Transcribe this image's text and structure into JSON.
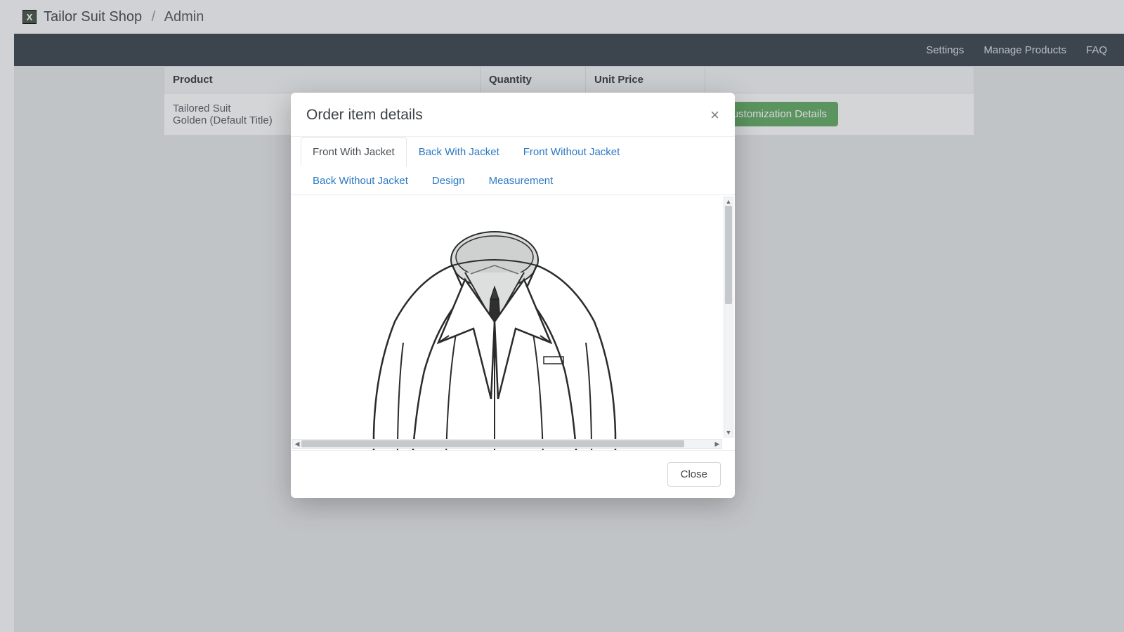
{
  "header": {
    "logo_letter": "X",
    "store_name": "Tailor Suit Shop",
    "separator": "/",
    "page": "Admin"
  },
  "navbar": {
    "settings": "Settings",
    "manage_products": "Manage Products",
    "faq": "FAQ"
  },
  "table": {
    "headers": {
      "product": "Product",
      "quantity": "Quantity",
      "unit_price": "Unit Price"
    },
    "rows": [
      {
        "product_line1": "Tailored Suit",
        "product_line2": "Golden (Default Title)",
        "action_label": "Customization Details"
      }
    ]
  },
  "modal": {
    "title": "Order item details",
    "close_glyph": "×",
    "tabs": [
      "Front With Jacket",
      "Back With Jacket",
      "Front Without Jacket",
      "Back Without Jacket",
      "Design",
      "Measurement"
    ],
    "active_tab_index": 0,
    "close_button": "Close"
  }
}
